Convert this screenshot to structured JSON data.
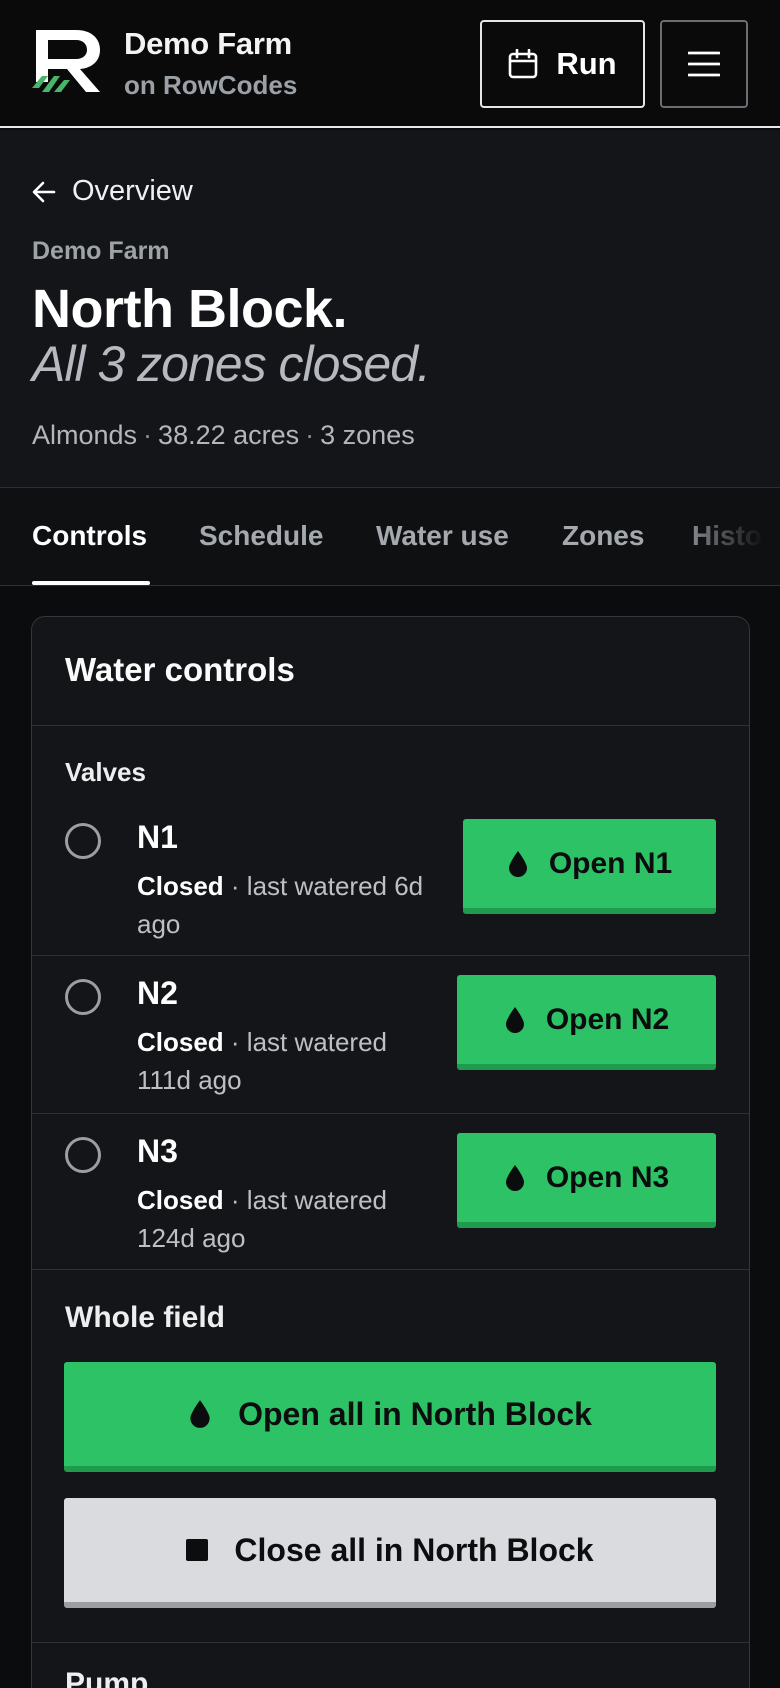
{
  "header": {
    "brand_name": "Demo Farm",
    "brand_sub": "on RowCodes",
    "run_label": "Run",
    "logo_icon": "rowcodes-logo",
    "accent": "#2ec266"
  },
  "hero": {
    "back_label": "Overview",
    "farm": "Demo Farm",
    "title": "North Block.",
    "subtitle": "All 3 zones closed.",
    "meta": [
      "Almonds",
      "38.22 acres",
      "3 zones"
    ],
    "meta_sep": "·"
  },
  "tabs": [
    "Controls",
    "Schedule",
    "Water use",
    "Zones",
    "History"
  ],
  "active_tab": "Controls",
  "water_controls": {
    "title": "Water controls",
    "valves_label": "Valves",
    "valves": [
      {
        "name": "N1",
        "status": "Closed",
        "detail": "· last watered 6d ago",
        "button": "Open N1"
      },
      {
        "name": "N2",
        "status": "Closed",
        "detail": "· last watered 111d ago",
        "button": "Open N2"
      },
      {
        "name": "N3",
        "status": "Closed",
        "detail": "· last watered 124d ago",
        "button": "Open N3"
      }
    ],
    "whole_field_label": "Whole field",
    "open_all": "Open all in North Block",
    "close_all": "Close all in North Block",
    "next_section": "Pump"
  },
  "colors": {
    "open_button": "#2ec266",
    "close_button": "#d9dbdf",
    "background": "#0b0c0e"
  }
}
